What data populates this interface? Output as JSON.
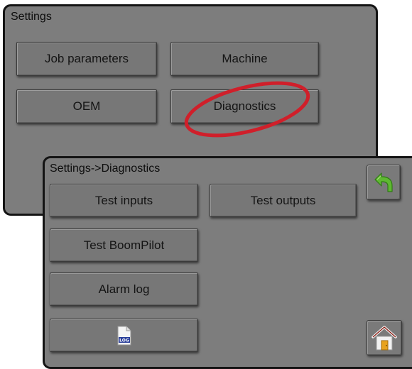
{
  "settings_panel": {
    "title": "Settings",
    "buttons": [
      {
        "label": "Job parameters"
      },
      {
        "label": "Machine"
      },
      {
        "label": "OEM"
      },
      {
        "label": "Diagnostics"
      }
    ]
  },
  "diagnostics_panel": {
    "title": "Settings->Diagnostics",
    "buttons": [
      {
        "label": "Test inputs"
      },
      {
        "label": "Test outputs"
      },
      {
        "label": "Test BoomPilot"
      },
      {
        "label": "Alarm log"
      }
    ],
    "log_button": {
      "icon": "log-file-icon",
      "icon_text": "LOG"
    },
    "back_button": {
      "icon": "back-arrow-icon"
    },
    "home_button": {
      "icon": "home-icon"
    }
  },
  "colors": {
    "panel_bg": "#7d7d7d",
    "button_bg": "#777777",
    "highlight": "#d01f2a",
    "back_arrow": "#5fb832",
    "home_door": "#e8a21c"
  }
}
